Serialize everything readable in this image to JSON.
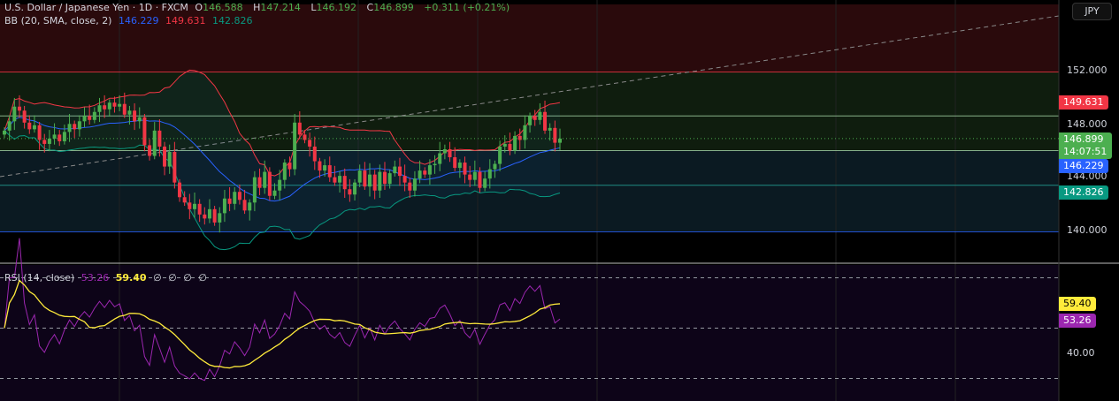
{
  "header": {
    "symbol": "U.S. Dollar / Japanese Yen · 1D · FXCM",
    "o_label": "O",
    "o": "146.588",
    "h_label": "H",
    "h": "147.214",
    "l_label": "L",
    "l": "146.192",
    "c_label": "C",
    "c": "146.899",
    "change": "+0.311 (+0.21%)"
  },
  "bb": {
    "label": "BB (20, SMA, close, 2)",
    "basis": "146.229",
    "upper": "149.631",
    "lower": "142.826"
  },
  "rsi": {
    "label": "RSI (14, close)",
    "value": "53.26",
    "ma": "59.40",
    "extra": [
      "∅",
      "∅",
      "∅",
      "∅"
    ]
  },
  "axis": {
    "currency": "JPY",
    "price_ticks": [
      "152.000",
      "148.000",
      "144.000",
      "140.000"
    ],
    "rsi_ticks": [
      "40.00"
    ],
    "tags": {
      "upper": "149.631",
      "last": "146.899",
      "countdown": "14:07:51",
      "basis": "146.229",
      "lower": "142.826",
      "rsi_ma": "59.40",
      "rsi": "53.26"
    }
  },
  "colors": {
    "up": "#4caf50",
    "down": "#f23645",
    "basis": "#2962ff",
    "upper": "#f23645",
    "lower": "#089981",
    "rsi": "#9c27b0",
    "rsi_ma": "#ffeb3b"
  },
  "chart_data": {
    "type": "candlestick",
    "title": "U.S. Dollar / Japanese Yen · 1D · FXCM",
    "ylim": [
      138,
      156
    ],
    "rsi_ylim": [
      20,
      80
    ],
    "levels": [
      151.9,
      148.6,
      146.0,
      143.4,
      139.9
    ],
    "close": [
      147.5,
      148.2,
      149.3,
      149.0,
      148.1,
      147.6,
      147.9,
      146.8,
      146.5,
      146.9,
      147.2,
      146.7,
      147.4,
      148.0,
      147.6,
      148.2,
      148.6,
      148.3,
      148.9,
      149.4,
      149.1,
      149.6,
      149.3,
      149.5,
      148.7,
      149.0,
      148.2,
      148.5,
      146.4,
      145.6,
      147.5,
      146.3,
      144.8,
      145.9,
      143.6,
      142.5,
      142.1,
      141.6,
      142.0,
      141.2,
      140.9,
      141.6,
      140.6,
      141.3,
      142.4,
      142.0,
      142.9,
      142.3,
      141.5,
      142.1,
      144.0,
      143.2,
      144.4,
      142.6,
      143.0,
      143.8,
      145.1,
      144.6,
      148.1,
      147.2,
      146.8,
      146.3,
      145.2,
      144.5,
      144.9,
      144.0,
      143.6,
      144.1,
      143.1,
      142.7,
      143.6,
      144.5,
      143.3,
      144.2,
      143.0,
      144.4,
      143.5,
      144.3,
      144.8,
      144.1,
      143.6,
      143.0,
      143.9,
      144.5,
      144.2,
      144.9,
      145.0,
      145.8,
      146.1,
      145.5,
      144.7,
      145.1,
      144.2,
      143.8,
      144.4,
      143.2,
      143.9,
      144.6,
      145.0,
      146.3,
      146.5,
      146.0,
      147.1,
      146.8,
      147.9,
      148.6,
      148.3,
      148.9,
      147.5,
      147.7,
      146.588,
      146.899
    ]
  }
}
